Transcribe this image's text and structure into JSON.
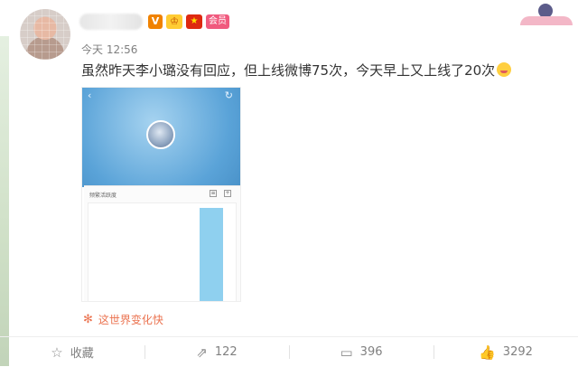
{
  "post": {
    "time": "今天 12:56",
    "text": "虽然昨天李小璐没有回应，但上线微博75次，今天早上又上线了20次",
    "emoji_icon": "yum-face-icon",
    "source": "这世界变化快"
  },
  "badges": {
    "verified": "V",
    "crown": "♔",
    "flag": "★",
    "member": "会员"
  },
  "embedded_screenshot": {
    "card_title": "频繁活跃度",
    "chart_bar_level": 0.95
  },
  "actions": [
    {
      "icon": "star-icon",
      "label": "收藏"
    },
    {
      "icon": "share-icon",
      "label": "122"
    },
    {
      "icon": "comment-icon",
      "label": "396"
    },
    {
      "icon": "like-icon",
      "label": "3292"
    }
  ],
  "colors": {
    "accent": "#eb7350",
    "sky": "#5aa3d8",
    "bar": "#8fd0ef"
  }
}
